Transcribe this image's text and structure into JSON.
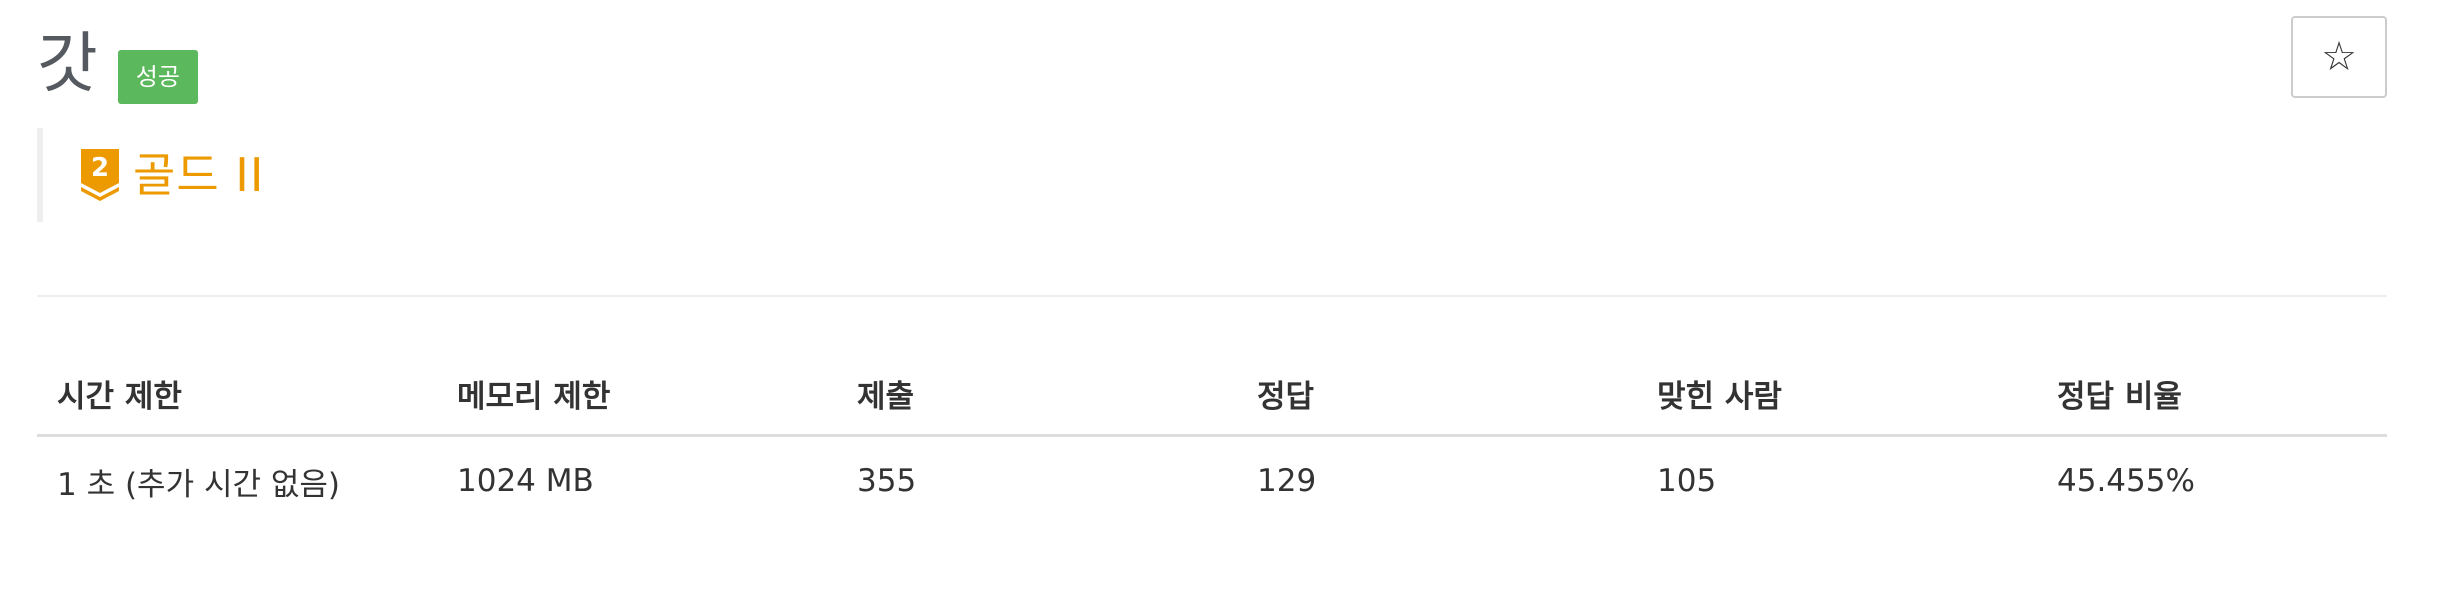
{
  "problem": {
    "title": "갓",
    "status_badge": "성공",
    "star_icon": "☆",
    "tier": {
      "icon": "gold-tier-2-icon",
      "icon_number": "2",
      "label": "골드 II",
      "color": "#ec9a00"
    }
  },
  "info_table": {
    "headers": [
      "시간 제한",
      "메모리 제한",
      "제출",
      "정답",
      "맞힌 사람",
      "정답 비율"
    ],
    "row": [
      "1 초 (추가 시간 없음)",
      "1024 MB",
      "355",
      "129",
      "105",
      "45.455%"
    ]
  },
  "colors": {
    "success_badge": "#5cb85c",
    "tier_gold": "#ec9a00"
  }
}
